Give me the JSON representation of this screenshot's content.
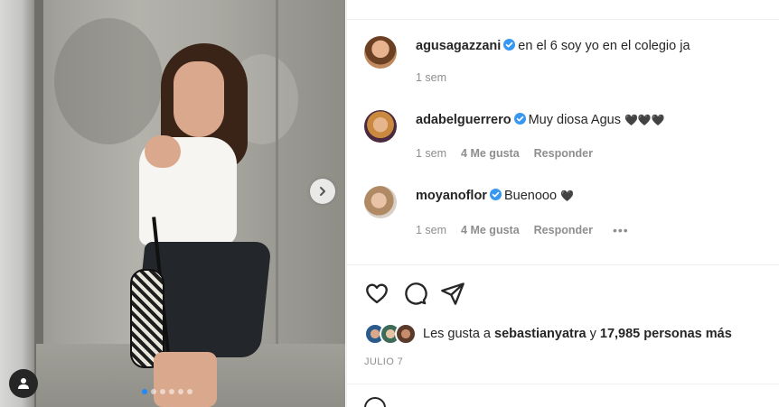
{
  "post": {
    "carousel": {
      "slides": 6,
      "current_slide": 1
    }
  },
  "caption": {
    "username": "agusagazzani",
    "verified": true,
    "text": "en el 6 soy yo en el colegio ja",
    "time": "1 sem"
  },
  "comments": [
    {
      "username": "adabelguerrero",
      "verified": true,
      "text": "Muy diosa Agus",
      "emoji": "🖤🖤🖤",
      "time": "1 sem",
      "likes": "4 Me gusta",
      "reply_label": "Responder"
    },
    {
      "username": "moyanoflor",
      "verified": true,
      "text": "Buenooo",
      "emoji": "🖤",
      "time": "1 sem",
      "likes": "4 Me gusta",
      "reply_label": "Responder",
      "more": "•••"
    }
  ],
  "likes_line": {
    "prefix": "Les gusta a",
    "user": "sebastianyatra",
    "connector": "y",
    "others": "17,985 personas más"
  },
  "date": "JULIO 7",
  "colors": {
    "verified": "#3897f0",
    "active_dot": "#1f8bf5",
    "text": "#262626",
    "muted": "#8e8e8e"
  },
  "icons": [
    "chevron-right-icon",
    "user-tag-icon",
    "heart-icon",
    "comment-icon",
    "share-icon",
    "verified-icon"
  ]
}
